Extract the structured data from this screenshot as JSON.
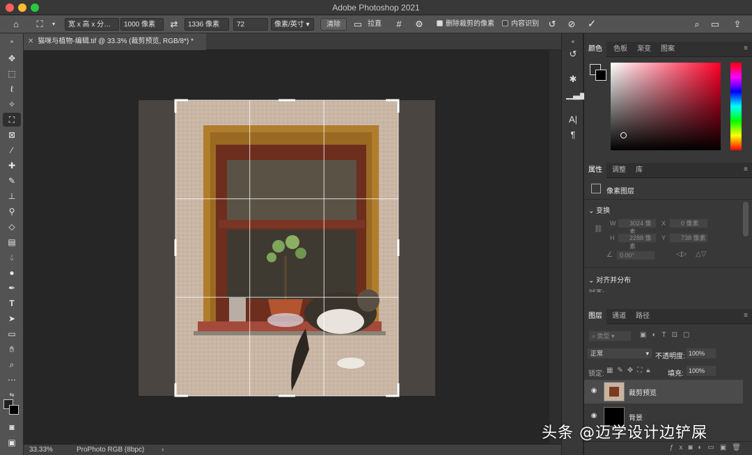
{
  "window": {
    "title": "Adobe Photoshop 2021"
  },
  "options_bar": {
    "ratio_preset": "宽 x 高 x 分…",
    "width": "1000 像素",
    "height": "1336 像素",
    "resolution": "72",
    "resolution_unit": "像素/英寸",
    "clear_label": "清除",
    "straighten_label": "拉直",
    "delete_cropped_label": "删除裁剪的像素",
    "delete_cropped_checked": true,
    "content_aware_label": "内容识别",
    "content_aware_checked": false
  },
  "document": {
    "tab_title": "猫咪与植物-编辑.tif @ 33.3% (裁剪预览, RGB/8*) *",
    "zoom": "33.33%",
    "color_profile": "ProPhoto RGB (8bpc)"
  },
  "color_panel": {
    "tabs": [
      "颜色",
      "色板",
      "渐变",
      "图案"
    ],
    "active": 0
  },
  "properties_panel": {
    "tabs": [
      "属性",
      "调整",
      "库"
    ],
    "active": 0,
    "layer_type": "像素图层",
    "transform_label": "变换",
    "w": "3024 像素",
    "x": "0 像素",
    "h": "2288 像素",
    "y": "738 像素",
    "angle": "0.00°",
    "align_label": "对齐并分布",
    "align_sub": "对齐:"
  },
  "layers_panel": {
    "tabs": [
      "图层",
      "通道",
      "路径"
    ],
    "active": 0,
    "filter_kind": "类型",
    "blend_mode": "正常",
    "opacity_label": "不透明度:",
    "opacity": "100%",
    "lock_label": "锁定:",
    "fill_label": "填充:",
    "fill": "100%",
    "layers": [
      {
        "name": "裁剪预览",
        "selected": true
      },
      {
        "name": "背景",
        "selected": false
      }
    ]
  },
  "watermark": "头条 @迈学设计边铲屎",
  "colors": {
    "accent": "#4a90d9",
    "panel": "#383838",
    "toolbar": "#535353"
  }
}
